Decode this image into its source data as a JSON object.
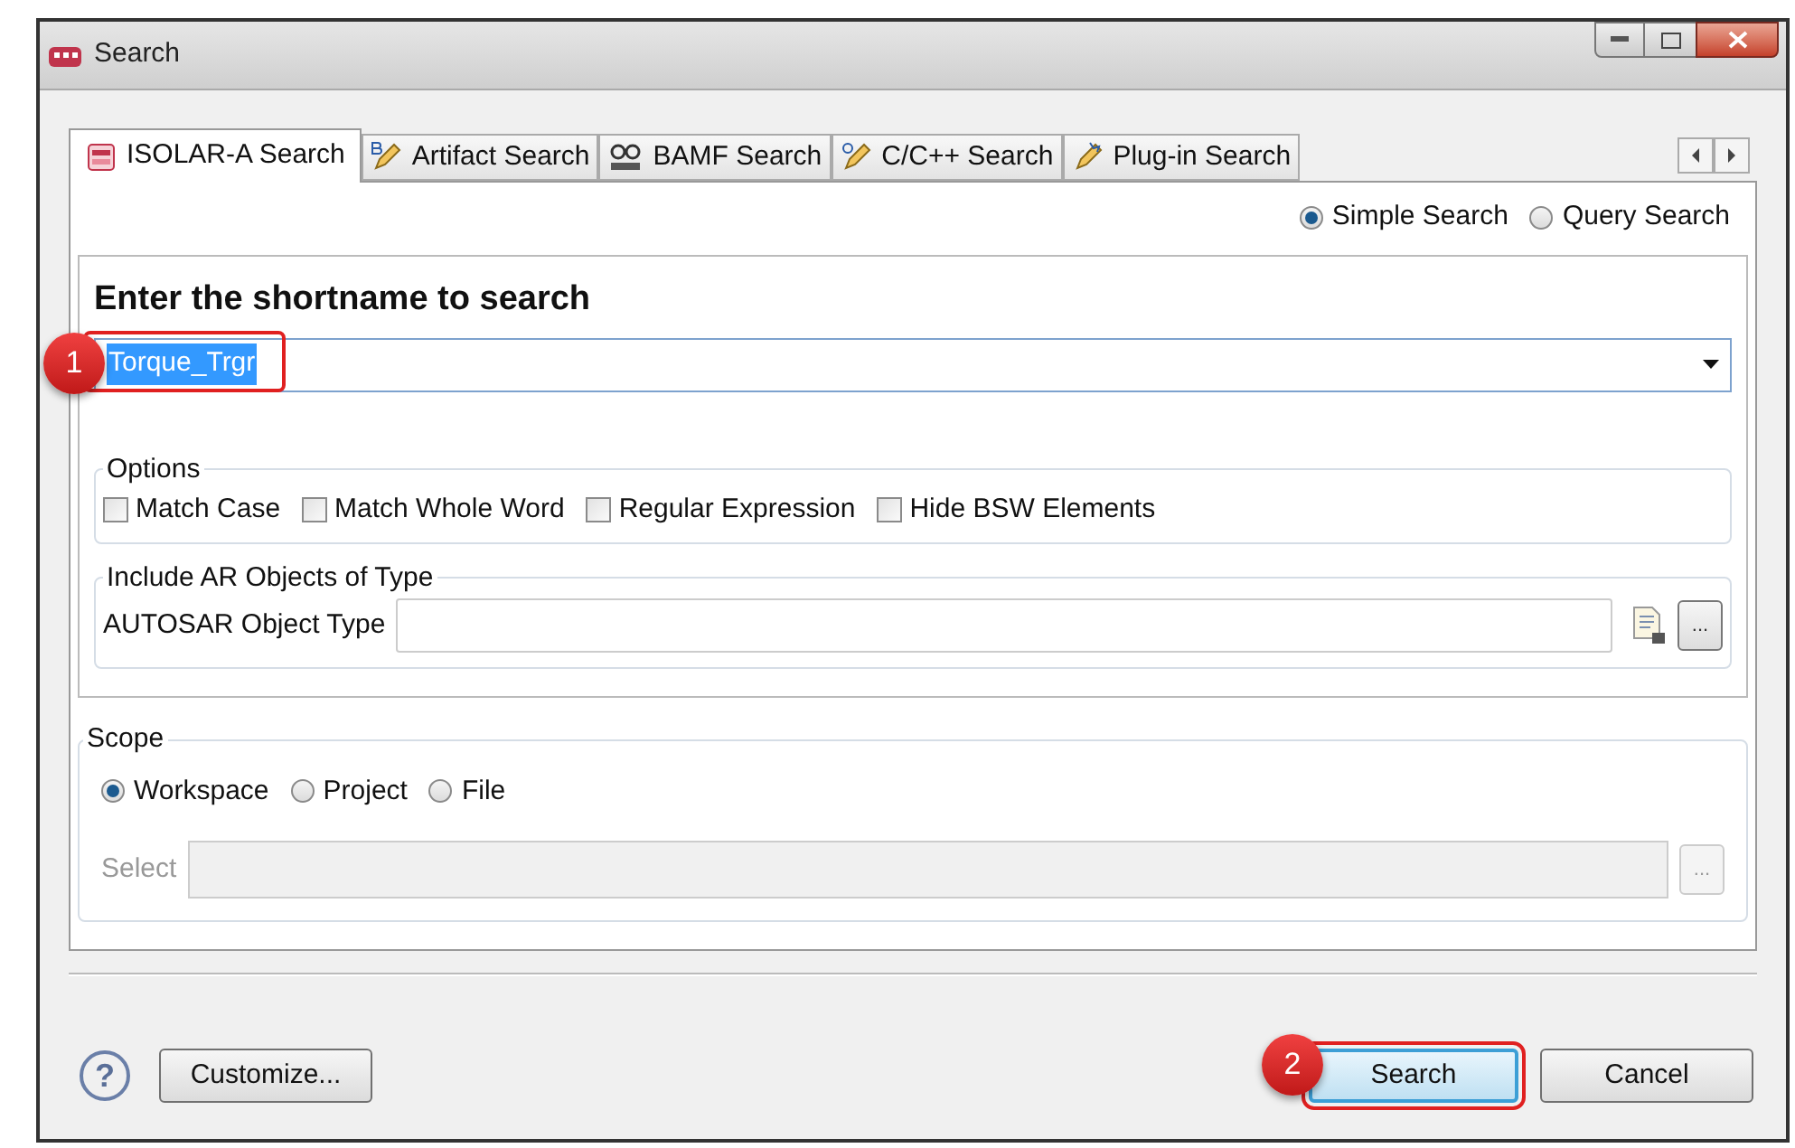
{
  "window": {
    "title": "Search"
  },
  "tabs": [
    {
      "label": "ISOLAR-A Search",
      "selected": true,
      "kind": "isolar"
    },
    {
      "label": "Artifact Search",
      "selected": false,
      "kind": "artifact"
    },
    {
      "label": "BAMF Search",
      "selected": false,
      "kind": "bamf"
    },
    {
      "label": "C/C++ Search",
      "selected": false,
      "kind": "cpp"
    },
    {
      "label": "Plug-in Search",
      "selected": false,
      "kind": "plugin"
    }
  ],
  "search_mode": [
    {
      "label": "Simple Search",
      "selected": true
    },
    {
      "label": "Query Search",
      "selected": false
    }
  ],
  "shortname": {
    "heading": "Enter the shortname to search",
    "value": "Torque_Trgr",
    "annotation": "1"
  },
  "options": {
    "title": "Options",
    "items": [
      {
        "label": "Match Case",
        "checked": false
      },
      {
        "label": "Match Whole Word",
        "checked": false
      },
      {
        "label": "Regular Expression",
        "checked": false
      },
      {
        "label": "Hide BSW Elements",
        "checked": false
      }
    ]
  },
  "include": {
    "title": "Include AR Objects of Type",
    "label": "AUTOSAR Object Type",
    "browse": "..."
  },
  "scope": {
    "title": "Scope",
    "items": [
      {
        "label": "Workspace",
        "selected": true
      },
      {
        "label": "Project",
        "selected": false
      },
      {
        "label": "File",
        "selected": false
      }
    ],
    "select_label": "Select",
    "browse": "...",
    "disabled": true
  },
  "buttons": {
    "help": "?",
    "customize": "Customize...",
    "search": "Search",
    "search_annotation": "2",
    "cancel": "Cancel"
  }
}
